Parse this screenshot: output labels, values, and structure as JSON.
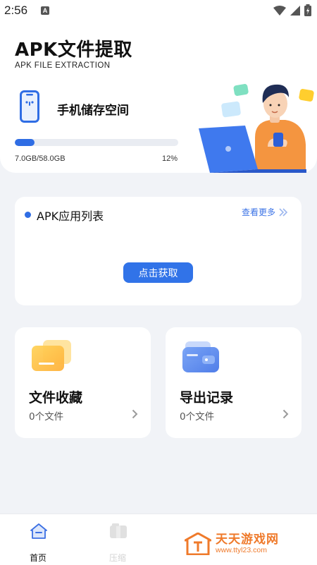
{
  "status_bar": {
    "time": "2:56",
    "badge": "A"
  },
  "header": {
    "title": "APK文件提取",
    "subtitle": "APK FILE EXTRACTION",
    "storage_label": "手机储存空间",
    "storage_used": "7.0GB/58.0GB",
    "storage_percent": "12%",
    "storage_fraction": 0.12
  },
  "apk_list": {
    "title": "APK应用列表",
    "see_more": "查看更多",
    "fetch_button": "点击获取"
  },
  "cards": {
    "favorites": {
      "title": "文件收藏",
      "count": "0个文件"
    },
    "exports": {
      "title": "导出记录",
      "count": "0个文件"
    }
  },
  "bottom_nav": {
    "home_label": "首页",
    "compress_label": "压缩"
  },
  "watermark": {
    "name": "天天游戏网",
    "url": "www.ttyl23.com"
  },
  "colors": {
    "accent": "#2f6de4",
    "background": "#f1f3f7",
    "watermark": "#ef7a2b"
  }
}
